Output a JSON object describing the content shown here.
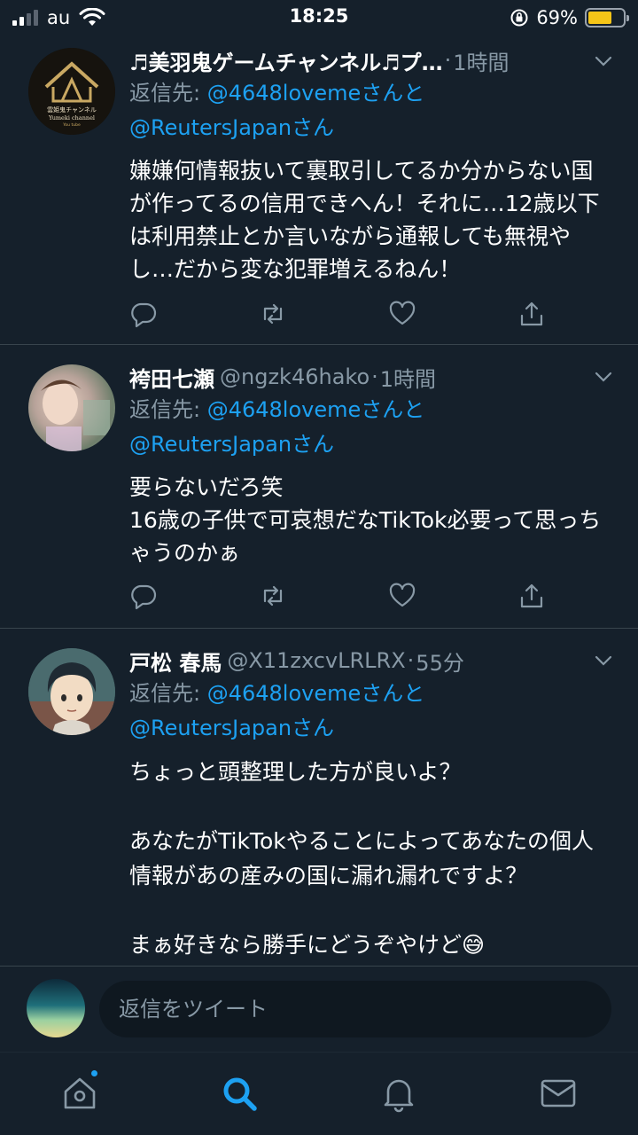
{
  "status_bar": {
    "carrier": "au",
    "time": "18:25",
    "battery": "69%",
    "battery_level": 0.69
  },
  "tweets": [
    {
      "name": "♬美羽鬼ゲームチャンネル♬プ…",
      "handle": "",
      "time": "1時間",
      "reply_prefix": "返信先: ",
      "mention1": "@4648lovemeさんと",
      "mention2": "@ReutersJapanさん",
      "body": "嫌嫌何情報抜いて裏取引してるか分からない国が作ってるの信用できへん！それに…12歳以下は利用禁止とか言いながら通報しても無視やし…だから変な犯罪増えるねん！",
      "avatar_text": {
        "line1": "雲姫鬼チャンネル",
        "line2": "Yumeki channel",
        "line3": "You tube"
      }
    },
    {
      "name": "袴田七瀬",
      "handle": "@ngzk46hako",
      "time": "1時間",
      "reply_prefix": "返信先: ",
      "mention1": "@4648lovemeさんと",
      "mention2": "@ReutersJapanさん",
      "body": "要らないだろ笑\n16歳の子供で可哀想だなTikTok必要って思っちゃうのかぁ"
    },
    {
      "name": "戸松 春馬",
      "handle": "@X11zxcvLRLRX",
      "time": "55分",
      "reply_prefix": "返信先: ",
      "mention1": "@4648lovemeさんと",
      "mention2": "@ReutersJapanさん",
      "body": "ちょっと頭整理した方が良いよ？\n\nあなたがTikTokやることによってあなたの個人情報があの産みの国に漏れ漏れですよ？\n\nまぁ好きなら勝手にどうぞやけど😅"
    }
  ],
  "reply_bar": {
    "placeholder": "返信をツイート"
  },
  "colors": {
    "background": "#15202b",
    "accent": "#1da1f2",
    "muted": "#8899a6",
    "divider": "#38444d"
  },
  "icons": [
    "reply-icon",
    "retweet-icon",
    "like-icon",
    "share-icon",
    "chevron-down-icon",
    "home-icon",
    "search-icon",
    "notifications-icon",
    "messages-icon"
  ]
}
